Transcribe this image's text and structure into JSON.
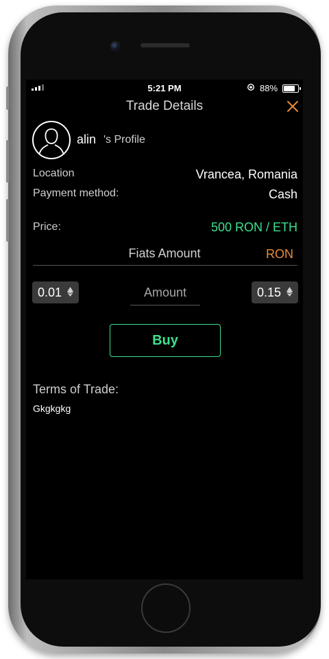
{
  "status_bar": {
    "time": "5:21 PM",
    "battery_percent": "88%",
    "battery_level": 0.88,
    "orientation_lock_icon": "orientation-lock-icon"
  },
  "header": {
    "title": "Trade Details",
    "close_icon": "close-icon",
    "accent_color": "#e98a3a"
  },
  "profile": {
    "username": "alin",
    "suffix": "'s Profile",
    "avatar_icon": "user-avatar-icon"
  },
  "details": {
    "location_label": "Location",
    "location_value": "Vrancea, Romania",
    "payment_label": "Payment method:",
    "payment_value": "Cash",
    "price_label": "Price:",
    "price_value": "500 RON / ETH"
  },
  "amount_section": {
    "fiats_label": "Fiats Amount",
    "fiat_currency": "RON",
    "min_value": "0.01",
    "max_value": "0.15",
    "amount_placeholder": "Amount",
    "eth_icon": "ethereum-icon"
  },
  "actions": {
    "buy_label": "Buy",
    "buy_color": "#3ee08f"
  },
  "terms": {
    "label": "Terms of Trade:",
    "text": "Gkgkgkg"
  }
}
